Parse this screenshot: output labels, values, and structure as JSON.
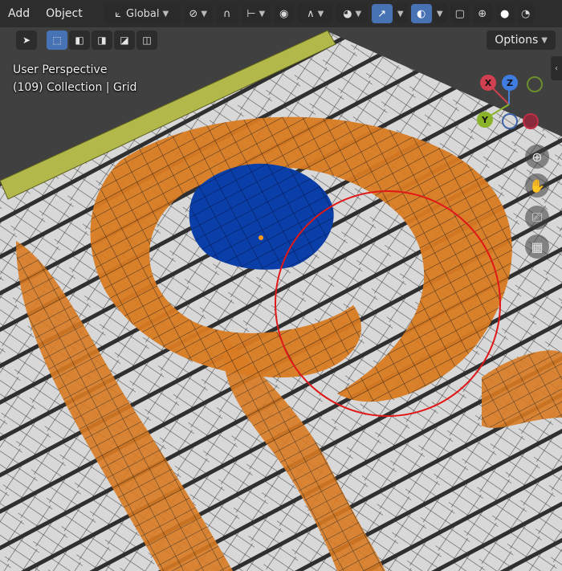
{
  "header": {
    "menu": [
      "Add",
      "Object"
    ],
    "transform_orientation": "Global",
    "options_label": "Options"
  },
  "overlay": {
    "view_name": "User Perspective",
    "collection_path": "(109) Collection | Grid"
  },
  "gizmo": {
    "x_label": "X",
    "z_label": "Z",
    "y_label": "Y"
  },
  "colors": {
    "blender_accent": "#4772b3",
    "mesh_white": "#d6d6d6",
    "paint_orange": "#d97b22",
    "paint_blue": "#0a3ea8",
    "grid_green": "#b3b84a",
    "brush_circle": "#e01818"
  },
  "icons": [
    "select-box-icon",
    "snap-icon",
    "proportional-edit-icon",
    "visibility-icon",
    "gizmo-icon",
    "overlay-icon",
    "xray-icon",
    "wireframe-shading-icon",
    "solid-shading-icon",
    "zoom-icon",
    "pan-hand-icon",
    "camera-icon",
    "grid-icon"
  ]
}
